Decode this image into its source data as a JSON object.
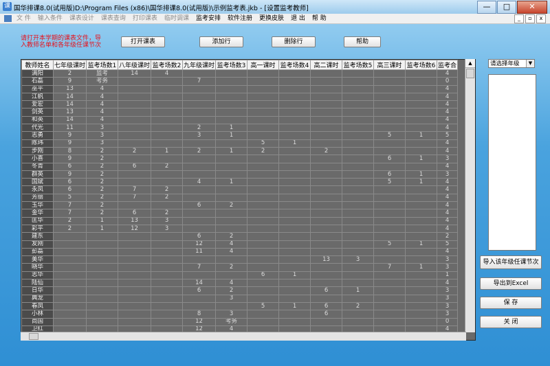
{
  "window": {
    "title": "国华排课8.0(试用版)D:\\Program Files (x86)\\国华排课8.0(试用版)\\示例监考表.jkb - [设置监考教师]",
    "controls": {
      "minimize": "—",
      "maximize": "□",
      "close": "✕"
    }
  },
  "menu": {
    "items": [
      {
        "label": "文 件",
        "dim": true
      },
      {
        "label": "输入条件",
        "dim": true
      },
      {
        "label": "课表设计",
        "dim": true
      },
      {
        "label": "课表查询",
        "dim": true
      },
      {
        "label": "打印课表",
        "dim": true
      },
      {
        "label": "临时调课",
        "dim": true
      },
      {
        "label": "监考安排",
        "dim": false
      },
      {
        "label": "软件注册",
        "dim": false
      },
      {
        "label": "更换皮肤",
        "dim": false
      },
      {
        "label": "退 出",
        "dim": false
      },
      {
        "label": "帮 助",
        "dim": false
      }
    ],
    "mdi": {
      "minimize": "_",
      "restore": "▫",
      "close": "x"
    }
  },
  "warning": "请打开本学期的课表文件，导入教师名单和各年级任课节次",
  "toolbar": {
    "open": "打开课表",
    "add": "添加行",
    "delete": "删除行",
    "help": "帮助"
  },
  "table": {
    "headers": [
      "教师姓名",
      "七年级课时",
      "监考场数1",
      "八年级课时",
      "监考场数2",
      "九年级课时",
      "监考场数3",
      "高一课时",
      "监考场数4",
      "高二课时",
      "监考场数5",
      "高三课时",
      "监考场数6",
      "监考合"
    ],
    "rows": [
      [
        "满阳",
        "2",
        "监考",
        "14",
        "4",
        "",
        "",
        "",
        "",
        "",
        "",
        "",
        "",
        "4"
      ],
      [
        "石磊",
        "9",
        "考务",
        "",
        "",
        "7",
        "",
        "",
        "",
        "",
        "",
        "",
        "",
        "0"
      ],
      [
        "巫平",
        "13",
        "4",
        "",
        "",
        "",
        "",
        "",
        "",
        "",
        "",
        "",
        "",
        "4"
      ],
      [
        "江帆",
        "14",
        "4",
        "",
        "",
        "",
        "",
        "",
        "",
        "",
        "",
        "",
        "",
        "4"
      ],
      [
        "爱宏",
        "14",
        "4",
        "",
        "",
        "",
        "",
        "",
        "",
        "",
        "",
        "",
        "",
        "4"
      ],
      [
        "剑英",
        "13",
        "4",
        "",
        "",
        "",
        "",
        "",
        "",
        "",
        "",
        "",
        "",
        "4"
      ],
      [
        "和英",
        "14",
        "4",
        "",
        "",
        "",
        "",
        "",
        "",
        "",
        "",
        "",
        "",
        "4"
      ],
      [
        "代光",
        "11",
        "3",
        "",
        "",
        "2",
        "1",
        "",
        "",
        "",
        "",
        "",
        "",
        "4"
      ],
      [
        "志勇",
        "9",
        "3",
        "",
        "",
        "3",
        "1",
        "",
        "",
        "",
        "",
        "5",
        "1",
        "5"
      ],
      [
        "陈玮",
        "9",
        "3",
        "",
        "",
        "",
        "",
        "5",
        "1",
        "",
        "",
        "",
        "",
        "4"
      ],
      [
        "步刚",
        "8",
        "2",
        "2",
        "1",
        "2",
        "1",
        "2",
        "",
        "2",
        "",
        "",
        "",
        "4"
      ],
      [
        "小喜",
        "9",
        "2",
        "",
        "",
        "",
        "",
        "",
        "",
        "",
        "",
        "6",
        "1",
        "3"
      ],
      [
        "冬青",
        "6",
        "2",
        "6",
        "2",
        "",
        "",
        "",
        "",
        "",
        "",
        "",
        "",
        "4"
      ],
      [
        "群英",
        "9",
        "2",
        "",
        "",
        "",
        "",
        "",
        "",
        "",
        "",
        "6",
        "1",
        "3"
      ],
      [
        "国斌",
        "6",
        "2",
        "",
        "",
        "4",
        "1",
        "",
        "",
        "",
        "",
        "5",
        "1",
        "4"
      ],
      [
        "永凤",
        "6",
        "2",
        "7",
        "2",
        "",
        "",
        "",
        "",
        "",
        "",
        "",
        "",
        "4"
      ],
      [
        "芳丽",
        "5",
        "2",
        "7",
        "2",
        "",
        "",
        "",
        "",
        "",
        "",
        "",
        "",
        "4"
      ],
      [
        "玉华",
        "7",
        "2",
        "",
        "",
        "6",
        "2",
        "",
        "",
        "",
        "",
        "",
        "",
        "4"
      ],
      [
        "金华",
        "7",
        "2",
        "6",
        "2",
        "",
        "",
        "",
        "",
        "",
        "",
        "",
        "",
        "4"
      ],
      [
        "匡华",
        "2",
        "1",
        "13",
        "3",
        "",
        "",
        "",
        "",
        "",
        "",
        "",
        "",
        "4"
      ],
      [
        "彩平",
        "2",
        "1",
        "12",
        "3",
        "",
        "",
        "",
        "",
        "",
        "",
        "",
        "",
        "4"
      ],
      [
        "建东",
        "",
        "",
        "",
        "",
        "6",
        "2",
        "",
        "",
        "",
        "",
        "",
        "",
        "2"
      ],
      [
        "友刚",
        "",
        "",
        "",
        "",
        "12",
        "4",
        "",
        "",
        "",
        "",
        "5",
        "1",
        "5"
      ],
      [
        "彭磊",
        "",
        "",
        "",
        "",
        "11",
        "4",
        "",
        "",
        "",
        "",
        "",
        "",
        "4"
      ],
      [
        "美华",
        "",
        "",
        "",
        "",
        "",
        "",
        "",
        "",
        "13",
        "3",
        "",
        "",
        "3"
      ],
      [
        "晓华",
        "",
        "",
        "",
        "",
        "7",
        "2",
        "",
        "",
        "",
        "",
        "7",
        "1",
        "3"
      ],
      [
        "志华",
        "",
        "",
        "",
        "",
        "",
        "",
        "6",
        "1",
        "",
        "",
        "",
        "",
        "1"
      ],
      [
        "陆仙",
        "",
        "",
        "",
        "",
        "14",
        "4",
        "",
        "",
        "",
        "",
        "",
        "",
        "4"
      ],
      [
        "日华",
        "",
        "",
        "",
        "",
        "6",
        "2",
        "",
        "",
        "6",
        "1",
        "",
        "",
        "3"
      ],
      [
        "典龙",
        "",
        "",
        "",
        "",
        "",
        "3",
        "",
        "",
        "",
        "",
        "",
        "",
        "3"
      ],
      [
        "春凤",
        "",
        "",
        "",
        "",
        "",
        "",
        "5",
        "1",
        "6",
        "2",
        "",
        "",
        "3"
      ],
      [
        "小林",
        "",
        "",
        "",
        "",
        "8",
        "3",
        "",
        "",
        "6",
        "",
        "",
        "",
        "3"
      ],
      [
        "尚国",
        "",
        "",
        "",
        "",
        "12",
        "考务",
        "",
        "",
        "",
        "",
        "",
        "",
        "0"
      ],
      [
        "卫红",
        "",
        "",
        "",
        "",
        "12",
        "4",
        "",
        "",
        "",
        "",
        "",
        "",
        "4"
      ]
    ]
  },
  "side": {
    "grade_select": "请选择年级",
    "import": "导入该年级任课节次",
    "export": "导出到Excel",
    "save": "保 存",
    "close": "关 闭"
  }
}
